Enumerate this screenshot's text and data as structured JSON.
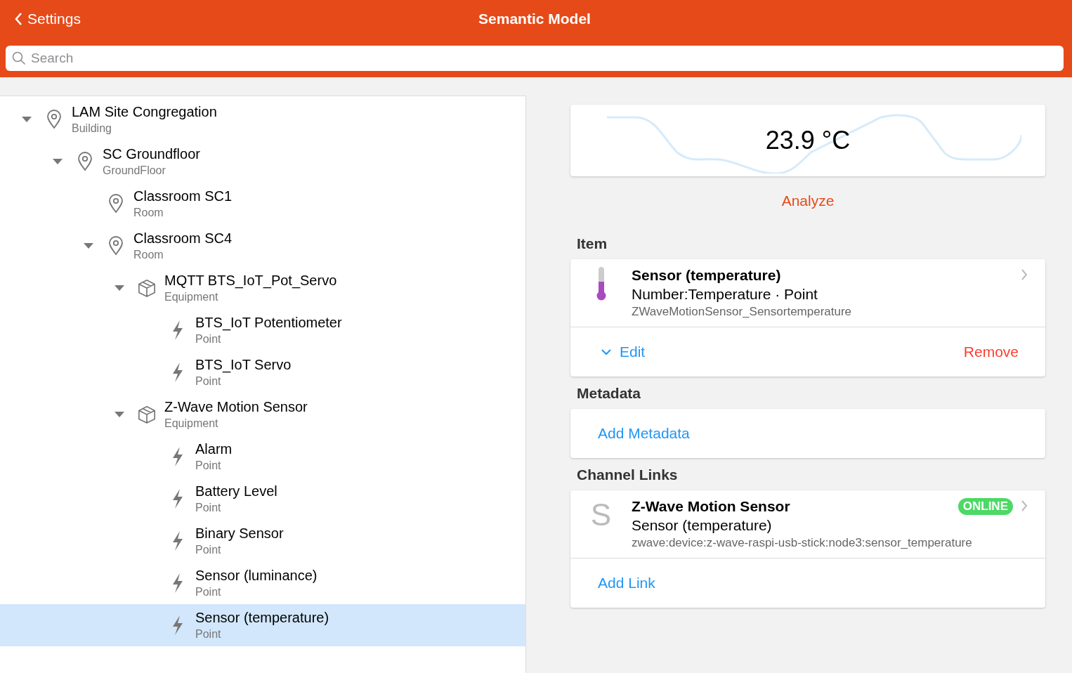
{
  "navbar": {
    "back_label": "Settings",
    "title": "Semantic Model"
  },
  "search": {
    "placeholder": "Search"
  },
  "tree": [
    {
      "name": "LAM Site Congregation",
      "type": "Building",
      "kind": "location",
      "expanded": true,
      "selected": false,
      "children": [
        {
          "name": "SC Groundfloor",
          "type": "GroundFloor",
          "kind": "location",
          "expanded": true,
          "selected": false,
          "children": [
            {
              "name": "Classroom SC1",
              "type": "Room",
              "kind": "location",
              "selected": false
            },
            {
              "name": "Classroom SC4",
              "type": "Room",
              "kind": "location",
              "expanded": true,
              "selected": false,
              "children": [
                {
                  "name": "MQTT BTS_IoT_Pot_Servo",
                  "type": "Equipment",
                  "kind": "equipment",
                  "expanded": true,
                  "selected": false,
                  "children": [
                    {
                      "name": "BTS_IoT Potentiometer",
                      "type": "Point",
                      "kind": "point",
                      "selected": false
                    },
                    {
                      "name": "BTS_IoT Servo",
                      "type": "Point",
                      "kind": "point",
                      "selected": false
                    }
                  ]
                },
                {
                  "name": "Z-Wave Motion Sensor",
                  "type": "Equipment",
                  "kind": "equipment",
                  "expanded": true,
                  "selected": false,
                  "children": [
                    {
                      "name": "Alarm",
                      "type": "Point",
                      "kind": "point",
                      "selected": false
                    },
                    {
                      "name": "Battery Level",
                      "type": "Point",
                      "kind": "point",
                      "selected": false
                    },
                    {
                      "name": "Binary Sensor",
                      "type": "Point",
                      "kind": "point",
                      "selected": false
                    },
                    {
                      "name": "Sensor (luminance)",
                      "type": "Point",
                      "kind": "point",
                      "selected": false
                    },
                    {
                      "name": "Sensor (temperature)",
                      "type": "Point",
                      "kind": "point",
                      "selected": true
                    }
                  ]
                }
              ]
            }
          ]
        }
      ]
    }
  ],
  "state_card": {
    "value": "23.9 °C"
  },
  "analyze_label": "Analyze",
  "item_section": {
    "heading": "Item",
    "title": "Sensor (temperature)",
    "subtitle": "Number:Temperature · Point",
    "footer": "ZWaveMotionSensor_Sensortemperature",
    "edit_label": "Edit",
    "remove_label": "Remove"
  },
  "metadata_section": {
    "heading": "Metadata",
    "add_label": "Add Metadata"
  },
  "channel_links": {
    "heading": "Channel Links",
    "links": [
      {
        "letter": "S",
        "title": "Z-Wave Motion Sensor",
        "subtitle": "Sensor (temperature)",
        "footer": "zwave:device:z-wave-raspi-usb-stick:node3:sensor_temperature",
        "status": "ONLINE",
        "online": true
      }
    ],
    "add_label": "Add Link"
  }
}
